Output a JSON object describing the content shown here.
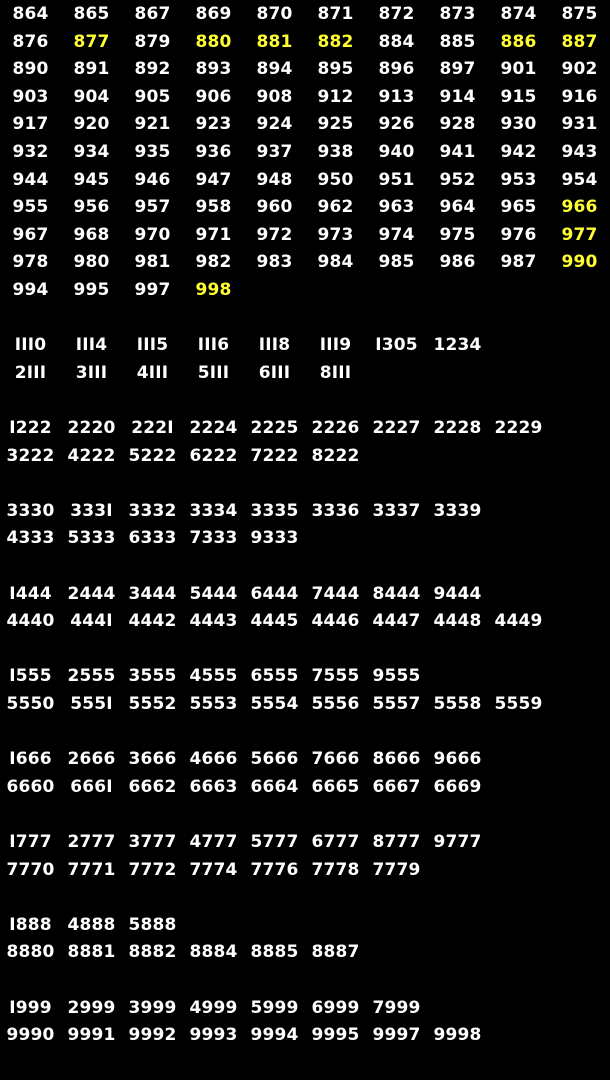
{
  "colors": {
    "background": "#000000",
    "text": "#ffffff",
    "highlight": "#ffff33"
  },
  "highlighted": [
    "877",
    "880",
    "881",
    "882",
    "886",
    "887",
    "966",
    "977",
    "990",
    "998"
  ],
  "rows": [
    [
      "864",
      "865",
      "867",
      "869",
      "870",
      "871",
      "872",
      "873",
      "874",
      "875"
    ],
    [
      "876",
      "877",
      "879",
      "880",
      "881",
      "882",
      "884",
      "885",
      "886",
      "887"
    ],
    [
      "890",
      "891",
      "892",
      "893",
      "894",
      "895",
      "896",
      "897",
      "901",
      "902"
    ],
    [
      "903",
      "904",
      "905",
      "906",
      "908",
      "912",
      "913",
      "914",
      "915",
      "916"
    ],
    [
      "917",
      "920",
      "921",
      "923",
      "924",
      "925",
      "926",
      "928",
      "930",
      "931"
    ],
    [
      "932",
      "934",
      "935",
      "936",
      "937",
      "938",
      "940",
      "941",
      "942",
      "943"
    ],
    [
      "944",
      "945",
      "946",
      "947",
      "948",
      "950",
      "951",
      "952",
      "953",
      "954"
    ],
    [
      "955",
      "956",
      "957",
      "958",
      "960",
      "962",
      "963",
      "964",
      "965",
      "966"
    ],
    [
      "967",
      "968",
      "970",
      "971",
      "972",
      "973",
      "974",
      "975",
      "976",
      "977"
    ],
    [
      "978",
      "980",
      "981",
      "982",
      "983",
      "984",
      "985",
      "986",
      "987",
      "990"
    ],
    [
      "994",
      "995",
      "997",
      "998"
    ],
    [],
    [
      "III0",
      "III4",
      "III5",
      "III6",
      "III8",
      "III9",
      "I305",
      "1234"
    ],
    [
      "2III",
      "3III",
      "4III",
      "5III",
      "6III",
      "8III"
    ],
    [],
    [
      "I222",
      "2220",
      "222I",
      "2224",
      "2225",
      "2226",
      "2227",
      "2228",
      "2229"
    ],
    [
      "3222",
      "4222",
      "5222",
      "6222",
      "7222",
      "8222"
    ],
    [],
    [
      "3330",
      "333I",
      "3332",
      "3334",
      "3335",
      "3336",
      "3337",
      "3339"
    ],
    [
      "4333",
      "5333",
      "6333",
      "7333",
      "9333"
    ],
    [],
    [
      "I444",
      "2444",
      "3444",
      "5444",
      "6444",
      "7444",
      "8444",
      "9444"
    ],
    [
      "4440",
      "444I",
      "4442",
      "4443",
      "4445",
      "4446",
      "4447",
      "4448",
      "4449"
    ],
    [],
    [
      "I555",
      "2555",
      "3555",
      "4555",
      "6555",
      "7555",
      "9555"
    ],
    [
      "5550",
      "555I",
      "5552",
      "5553",
      "5554",
      "5556",
      "5557",
      "5558",
      "5559"
    ],
    [],
    [
      "I666",
      "2666",
      "3666",
      "4666",
      "5666",
      "7666",
      "8666",
      "9666"
    ],
    [
      "6660",
      "666I",
      "6662",
      "6663",
      "6664",
      "6665",
      "6667",
      "6669"
    ],
    [],
    [
      "I777",
      "2777",
      "3777",
      "4777",
      "5777",
      "6777",
      "8777",
      "9777"
    ],
    [
      "7770",
      "7771",
      "7772",
      "7774",
      "7776",
      "7778",
      "7779"
    ],
    [],
    [
      "I888",
      "4888",
      "5888"
    ],
    [
      "8880",
      "8881",
      "8882",
      "8884",
      "8885",
      "8887"
    ],
    [],
    [
      "I999",
      "2999",
      "3999",
      "4999",
      "5999",
      "6999",
      "7999"
    ],
    [
      "9990",
      "9991",
      "9992",
      "9993",
      "9994",
      "9995",
      "9997",
      "9998"
    ]
  ]
}
